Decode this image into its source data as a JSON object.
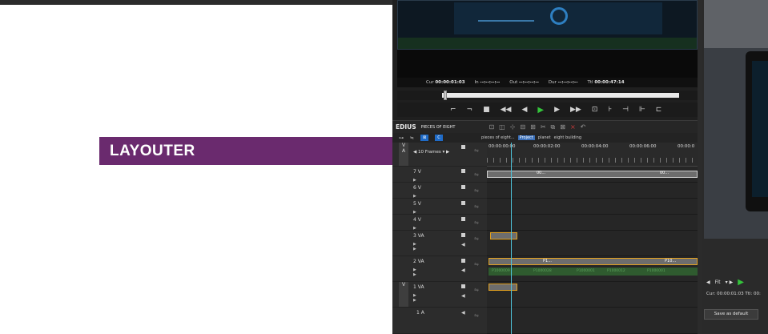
{
  "overlay": {
    "title": "LAYOUTER"
  },
  "player": {
    "timecodes": [
      {
        "label": "Cur",
        "value": "00:00:01:03"
      },
      {
        "label": "In",
        "value": "--:--:--:--"
      },
      {
        "label": "Out",
        "value": "--:--:--:--"
      },
      {
        "label": "Dur",
        "value": "--:--:--:--"
      },
      {
        "label": "Ttl",
        "value": "00:00:47:14"
      }
    ],
    "transport_buttons": [
      "mark-in",
      "mark-out",
      "stop",
      "rewind",
      "step-back",
      "play",
      "step-forward",
      "fast-forward",
      "insert",
      "trim-in",
      "trim-out",
      "match-frame",
      "export"
    ]
  },
  "timeline": {
    "app_name": "EDIUS",
    "project_name": "PIECES OF EIGHT",
    "breadcrumb": [
      "pieces of eight...",
      "Project",
      "planet",
      "eight building"
    ],
    "active_tab": "Project",
    "ruler_timecodes": [
      "00:00:00:00",
      "00:00:02:00",
      "00:00:04:00",
      "00:00:06:00",
      "00:00:0"
    ],
    "zoom_label": "10 Frames",
    "tracks": [
      {
        "label": "7 V"
      },
      {
        "label": "6 V"
      },
      {
        "label": "5 V"
      },
      {
        "label": "4 V"
      },
      {
        "label": "3 VA"
      },
      {
        "label": "2 VA"
      },
      {
        "label": "1 VA"
      },
      {
        "label": "1 A"
      }
    ],
    "side_tags": [
      "V",
      "A",
      "V"
    ],
    "clip_names": [
      "00...",
      "00...",
      "P1...",
      "P10..."
    ],
    "audio_labels": [
      "P1000009",
      "P1000028",
      "P1000001",
      "P1000012",
      "P1000001"
    ]
  },
  "right_panel": {
    "fit_label": "Fit",
    "cur_text": "Cur: 00:00:01:03  Ttl: 00:",
    "save_button": "Save as default"
  }
}
